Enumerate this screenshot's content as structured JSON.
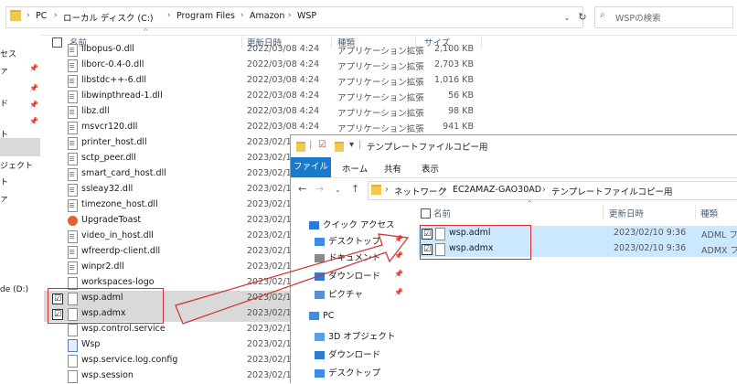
{
  "back_window": {
    "breadcrumb": [
      "PC",
      "ローカル ディスク (C:)",
      "Program Files",
      "Amazon",
      "WSP"
    ],
    "search_placeholder": "WSPの検索",
    "nav_fragments": [
      "セス",
      "ァ",
      "ド",
      "ト",
      "ジェクト",
      "ト",
      "ァ",
      "de (D:)"
    ],
    "columns": {
      "name": "名前",
      "date": "更新日時",
      "type": "種類",
      "size": "サイズ"
    },
    "files": [
      {
        "name": "libopus-0.dll",
        "date": "2022/03/08 4:24",
        "type": "アプリケーション拡張",
        "size": "2,100 KB",
        "icon": "dll-file-icon"
      },
      {
        "name": "liborc-0.4-0.dll",
        "date": "2022/03/08 4:24",
        "type": "アプリケーション拡張",
        "size": "2,703 KB",
        "icon": "dll-file-icon"
      },
      {
        "name": "libstdc++-6.dll",
        "date": "2022/03/08 4:24",
        "type": "アプリケーション拡張",
        "size": "1,016 KB",
        "icon": "dll-file-icon"
      },
      {
        "name": "libwinpthread-1.dll",
        "date": "2022/03/08 4:24",
        "type": "アプリケーション拡張",
        "size": "56 KB",
        "icon": "dll-file-icon"
      },
      {
        "name": "libz.dll",
        "date": "2022/03/08 4:24",
        "type": "アプリケーション拡張",
        "size": "98 KB",
        "icon": "dll-file-icon"
      },
      {
        "name": "msvcr120.dll",
        "date": "2022/03/08 4:24",
        "type": "アプリケーション拡張",
        "size": "941 KB",
        "icon": "dll-file-icon"
      },
      {
        "name": "printer_host.dll",
        "date": "2023/02/1(",
        "type": "",
        "size": "",
        "icon": "dll-file-icon"
      },
      {
        "name": "sctp_peer.dll",
        "date": "2023/02/1(",
        "type": "",
        "size": "",
        "icon": "dll-file-icon"
      },
      {
        "name": "smart_card_host.dll",
        "date": "2023/02/1(",
        "type": "",
        "size": "",
        "icon": "dll-file-icon"
      },
      {
        "name": "ssleay32.dll",
        "date": "2023/02/1(",
        "type": "",
        "size": "",
        "icon": "dll-file-icon"
      },
      {
        "name": "timezone_host.dll",
        "date": "2023/02/1(",
        "type": "",
        "size": "",
        "icon": "dll-file-icon"
      },
      {
        "name": "UpgradeToast",
        "date": "2023/02/1(",
        "type": "",
        "size": "",
        "icon": "app-icon"
      },
      {
        "name": "video_in_host.dll",
        "date": "2023/02/1(",
        "type": "",
        "size": "",
        "icon": "dll-file-icon"
      },
      {
        "name": "wfreerdp-client.dll",
        "date": "2023/02/1(",
        "type": "",
        "size": "",
        "icon": "dll-file-icon"
      },
      {
        "name": "winpr2.dll",
        "date": "2023/02/1(",
        "type": "",
        "size": "",
        "icon": "dll-file-icon"
      },
      {
        "name": "workspaces-logo",
        "date": "2023/02/1(",
        "type": "",
        "size": "",
        "icon": "file-icon"
      },
      {
        "name": "wsp.adml",
        "date": "2023/02/1(",
        "type": "",
        "size": "",
        "icon": "file-icon",
        "selected": true,
        "check": "☑"
      },
      {
        "name": "wsp.admx",
        "date": "2023/02/1(",
        "type": "",
        "size": "",
        "icon": "file-icon",
        "selected": true,
        "check": "☑"
      },
      {
        "name": "wsp.control.service",
        "date": "2023/02/1(",
        "type": "",
        "size": "",
        "icon": "file-icon"
      },
      {
        "name": "Wsp",
        "date": "2023/02/1(",
        "type": "",
        "size": "",
        "icon": "exe-icon"
      },
      {
        "name": "wsp.service.log.config",
        "date": "2023/02/1(",
        "type": "",
        "size": "",
        "icon": "file-icon"
      },
      {
        "name": "wsp.session",
        "date": "2023/02/1(",
        "type": "",
        "size": "",
        "icon": "file-icon"
      }
    ]
  },
  "front_window": {
    "title": "テンプレートファイルコピー用",
    "ribbon_tabs": [
      "ファイル",
      "ホーム",
      "共有",
      "表示"
    ],
    "address": [
      "ネットワーク",
      "EC2AMAZ-GAO30AD",
      "テンプレートファイルコピー用"
    ],
    "nav_items": [
      {
        "label": "クイック アクセス",
        "icon": "star-icon",
        "color": "#2e7bd6"
      },
      {
        "label": "デスクトップ",
        "icon": "desktop-icon",
        "color": "#3b8ee0"
      },
      {
        "label": "ドキュメント",
        "icon": "documents-icon",
        "color": "#8a8a8a"
      },
      {
        "label": "ダウンロード",
        "icon": "download-icon",
        "color": "#2e7bd6"
      },
      {
        "label": "ピクチャ",
        "icon": "pictures-icon",
        "color": "#5a8fcf"
      },
      {
        "label": "PC",
        "icon": "pc-icon",
        "color": "#3b8ee0"
      },
      {
        "label": "3D オブジェクト",
        "icon": "3d-objects-icon",
        "color": "#5aa0e8"
      },
      {
        "label": "ダウンロード",
        "icon": "download-icon",
        "color": "#2e7bd6"
      },
      {
        "label": "デスクトップ",
        "icon": "desktop-icon",
        "color": "#3b8ee0"
      }
    ],
    "columns": {
      "name": "名前",
      "date": "更新日時",
      "type": "種類"
    },
    "files": [
      {
        "name": "wsp.adml",
        "date": "2023/02/10 9:36",
        "type": "ADML ファ",
        "check": "☑"
      },
      {
        "name": "wsp.admx",
        "date": "2023/02/10 9:36",
        "type": "ADMX ファ",
        "check": "☑"
      }
    ]
  },
  "colors": {
    "highlight": "#d03030",
    "selection_grey": "#d9d9d9",
    "selection_blue": "#cce8ff",
    "file_tab": "#1979ca"
  }
}
